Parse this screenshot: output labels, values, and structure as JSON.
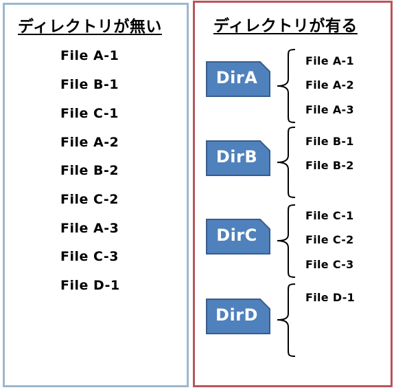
{
  "left_panel": {
    "title": "ディレクトリが無い",
    "files": [
      "File A-1",
      "File B-1",
      "File C-1",
      "File A-2",
      "File B-2",
      "File C-2",
      "File A-3",
      "File C-3",
      "File D-1"
    ]
  },
  "right_panel": {
    "title": "ディレクトリが有る",
    "directories": [
      {
        "name": "DirA",
        "files": [
          "File A-1",
          "File A-2",
          "File A-3"
        ]
      },
      {
        "name": "DirB",
        "files": [
          "File B-1",
          "File B-2"
        ]
      },
      {
        "name": "DirC",
        "files": [
          "File C-1",
          "File C-2",
          "File C-3"
        ]
      },
      {
        "name": "DirD",
        "files": [
          "File D-1"
        ]
      }
    ]
  },
  "colors": {
    "left_border": "#9ab8cf",
    "right_border": "#b9545a",
    "dir_fill": "#4f81bd",
    "dir_stroke": "#385d8a"
  }
}
